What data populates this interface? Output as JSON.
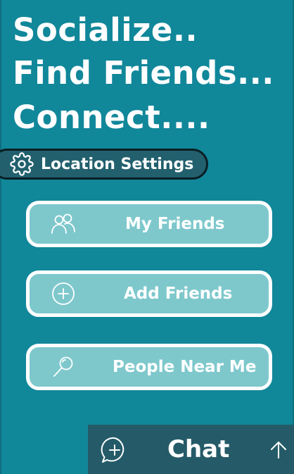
{
  "header": {
    "line1": "Socialize..",
    "line2": "Find Friends...",
    "line3": "Connect...."
  },
  "location_settings": {
    "label": "Location Settings",
    "icon": "gear-icon"
  },
  "menu": {
    "items": [
      {
        "label": "My Friends",
        "icon": "people-icon"
      },
      {
        "label": "Add Friends",
        "icon": "plus-circle-icon"
      },
      {
        "label": "People Near Me",
        "icon": "search-icon"
      }
    ]
  },
  "chat_bar": {
    "label": "Chat",
    "icon": "chat-plus-icon",
    "arrow_icon": "arrow-up-icon"
  },
  "colors": {
    "background": "#11879a",
    "button_fill": "#7ec8cc",
    "button_border": "#ffffff",
    "pill_fill": "#23606e",
    "chat_bar": "#255b68",
    "text": "#ffffff"
  }
}
